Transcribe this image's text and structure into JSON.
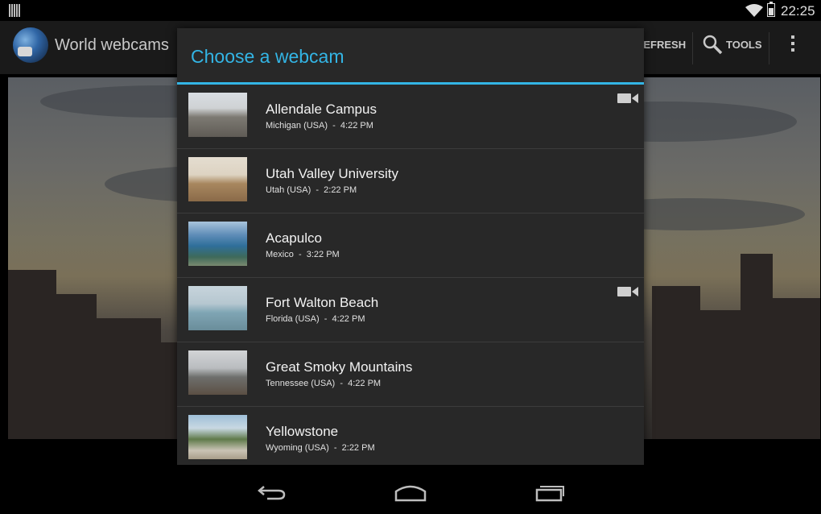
{
  "status_bar": {
    "time": "22:25"
  },
  "action_bar": {
    "app_title": "World webcams",
    "refresh_label": "REFRESH",
    "tools_label": "TOOLS"
  },
  "dialog": {
    "title": "Choose a webcam",
    "accent_color": "#33b5e5",
    "items": [
      {
        "name": "Allendale Campus",
        "location": "Michigan (USA)",
        "time": "4:22 PM",
        "has_video": true
      },
      {
        "name": "Utah Valley University",
        "location": "Utah (USA)",
        "time": "2:22 PM",
        "has_video": false
      },
      {
        "name": "Acapulco",
        "location": "Mexico",
        "time": "3:22 PM",
        "has_video": false
      },
      {
        "name": "Fort Walton Beach",
        "location": "Florida (USA)",
        "time": "4:22 PM",
        "has_video": true
      },
      {
        "name": "Great Smoky Mountains",
        "location": "Tennessee (USA)",
        "time": "4:22 PM",
        "has_video": false
      },
      {
        "name": "Yellowstone",
        "location": "Wyoming (USA)",
        "time": "2:22 PM",
        "has_video": false
      }
    ]
  },
  "nav_bar": {
    "icons": [
      "back-icon",
      "home-icon",
      "recent-apps-icon"
    ]
  }
}
